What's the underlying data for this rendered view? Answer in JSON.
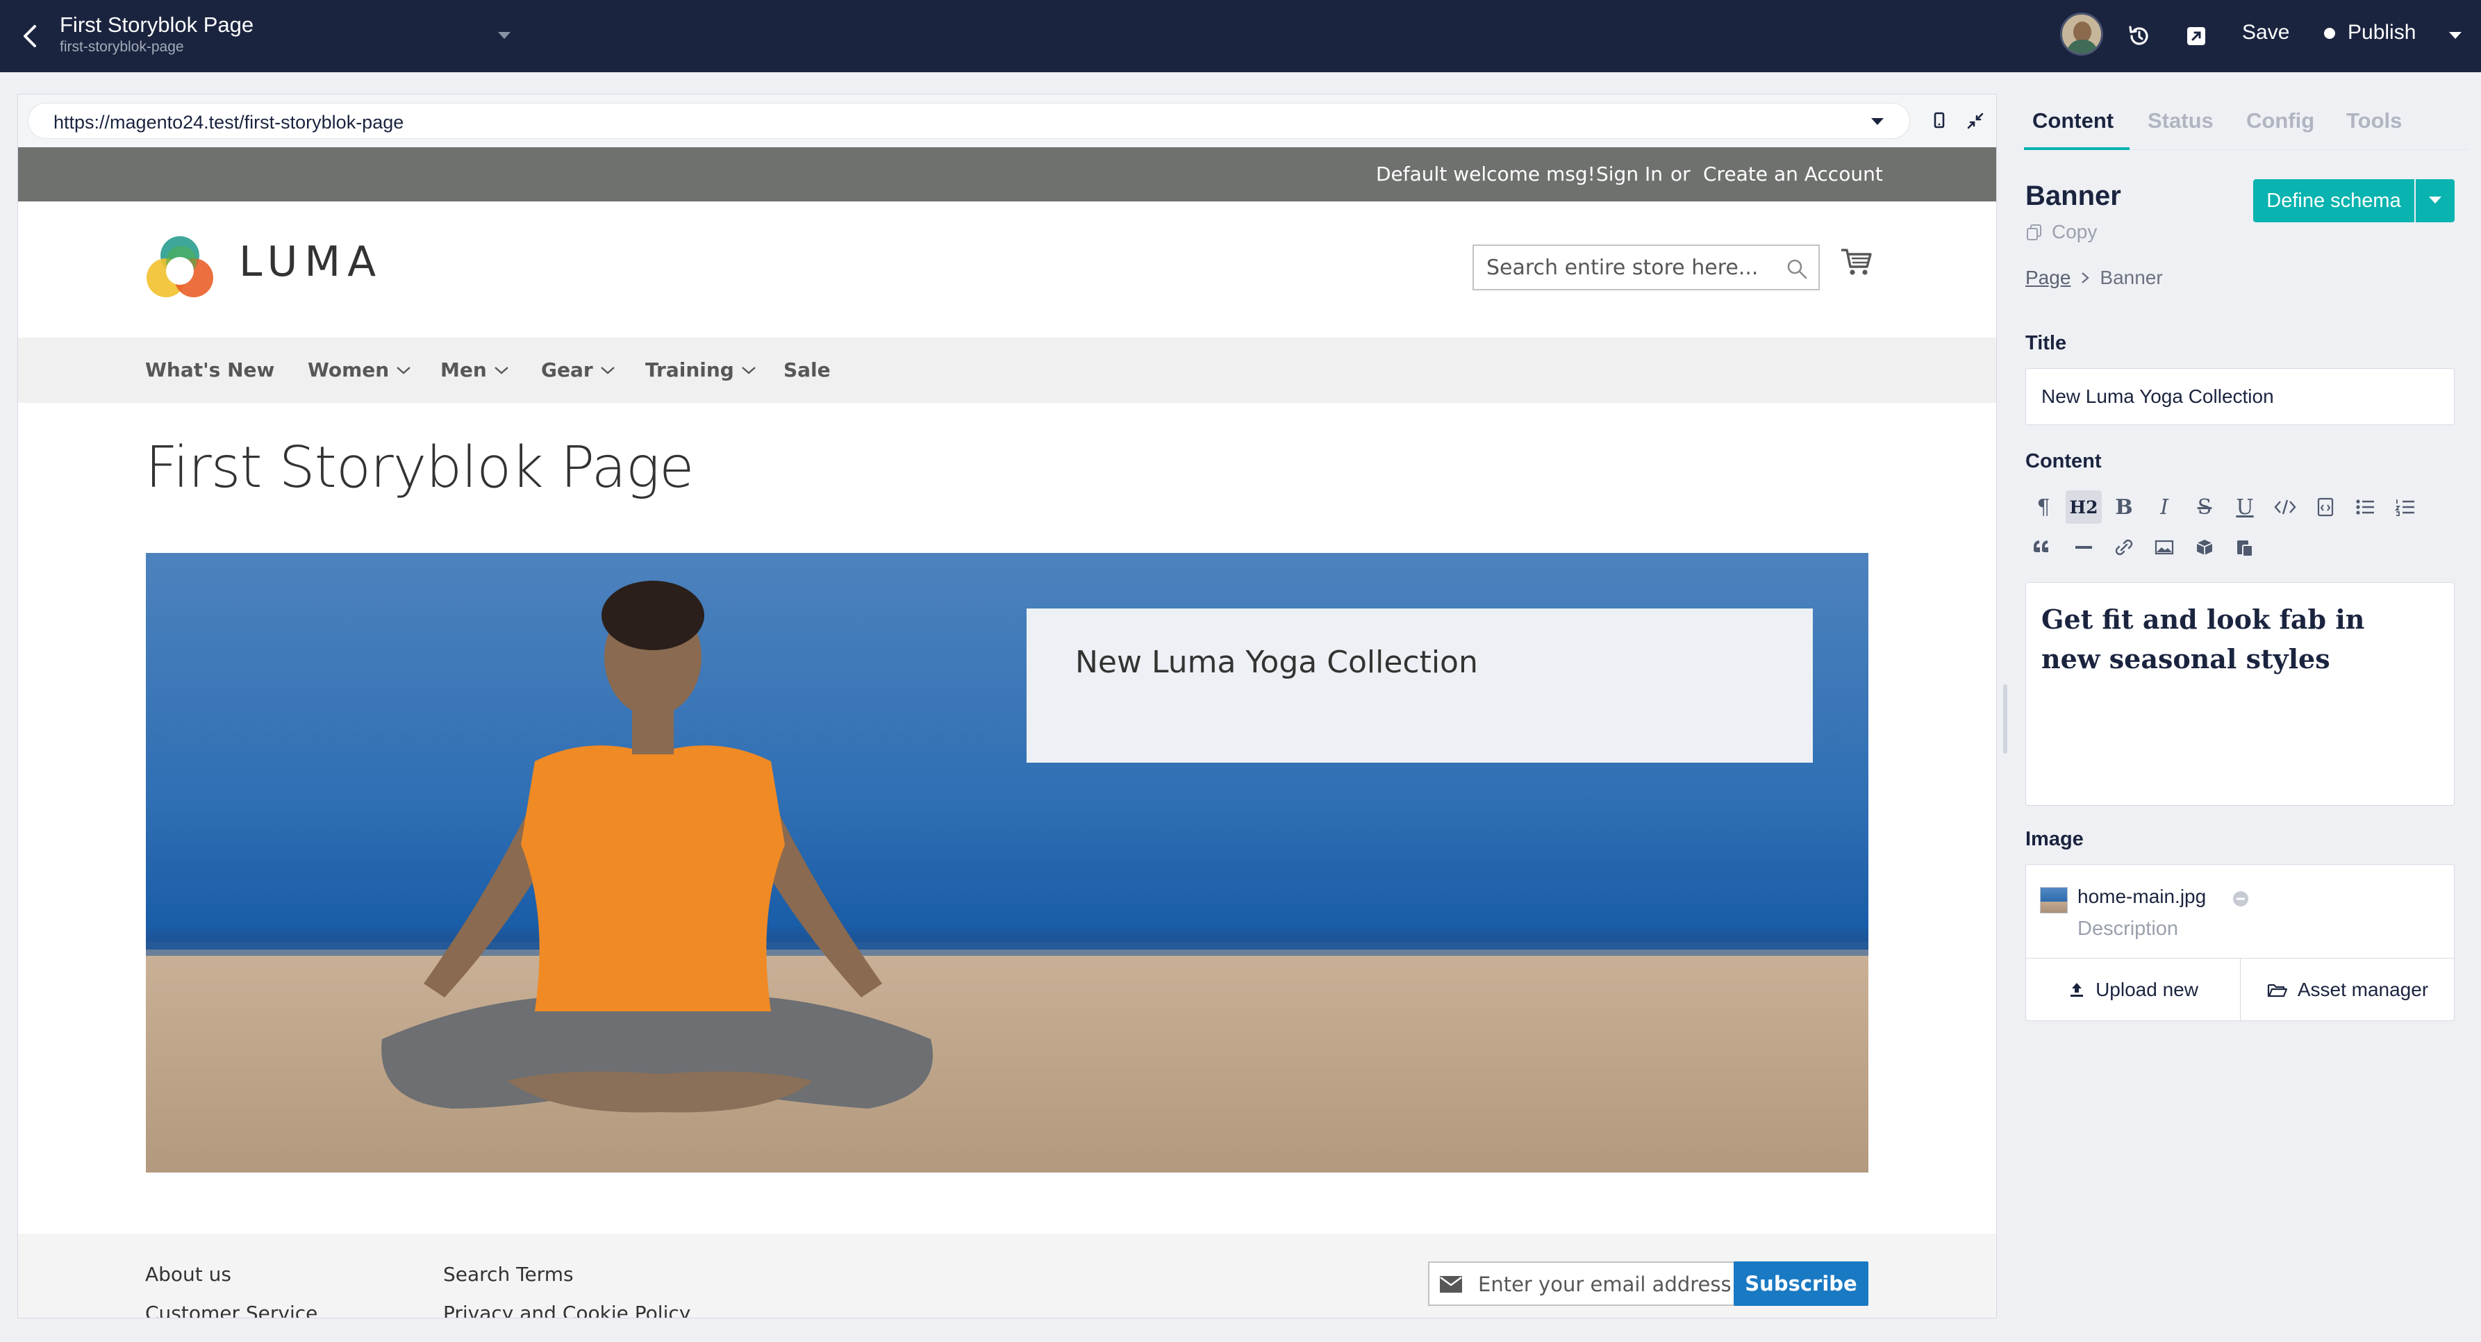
{
  "topbar": {
    "title": "First Storyblok Page",
    "slug": "first-storyblok-page",
    "save_label": "Save",
    "publish_label": "Publish",
    "icons": [
      "back-icon",
      "chevron-down-icon",
      "avatar",
      "history-icon",
      "open-external-icon",
      "chevron-down-icon"
    ]
  },
  "preview": {
    "url": "https://magento24.test/first-storyblok-page",
    "icons": [
      "chevron-down-icon",
      "mobile-device-icon",
      "collapse-icon"
    ]
  },
  "site": {
    "welcome": "Default welcome msg!",
    "sign_in": "Sign In",
    "or": "or",
    "create_account": "Create an Account",
    "logo_text": "LUMA",
    "search_placeholder": "Search entire store here...",
    "nav": {
      "whats_new": "What's New",
      "women": "Women",
      "men": "Men",
      "gear": "Gear",
      "training": "Training",
      "sale": "Sale"
    },
    "page_title": "First Storyblok Page",
    "banner_title": "New Luma Yoga Collection",
    "footer": {
      "about": "About us",
      "customer_service": "Customer Service",
      "search_terms": "Search Terms",
      "privacy": "Privacy and Cookie Policy",
      "email_placeholder": "Enter your email address",
      "subscribe": "Subscribe"
    }
  },
  "panel": {
    "tabs": {
      "content": "Content",
      "status": "Status",
      "config": "Config",
      "tools": "Tools"
    },
    "active_tab": "Content",
    "component_name": "Banner",
    "copy_label": "Copy",
    "define_schema": "Define schema",
    "breadcrumb": {
      "page": "Page",
      "current": "Banner"
    },
    "title_label": "Title",
    "title_value": "New Luma Yoga Collection",
    "content_label": "Content",
    "toolbar": {
      "paragraph": "¶",
      "h2": "H2",
      "bold": "B",
      "italic": "I",
      "strike": "S",
      "underline": "U"
    },
    "content_text": "Get fit and look fab in new seasonal styles",
    "image_label": "Image",
    "image": {
      "filename": "home-main.jpg",
      "description_placeholder": "Description",
      "upload_new": "Upload new",
      "asset_manager": "Asset manager"
    }
  },
  "colors": {
    "topbar_bg": "#1b243f",
    "accent_teal": "#09b3af",
    "luma_topbar": "#6e716e",
    "subscribe_blue": "#1979c3"
  }
}
